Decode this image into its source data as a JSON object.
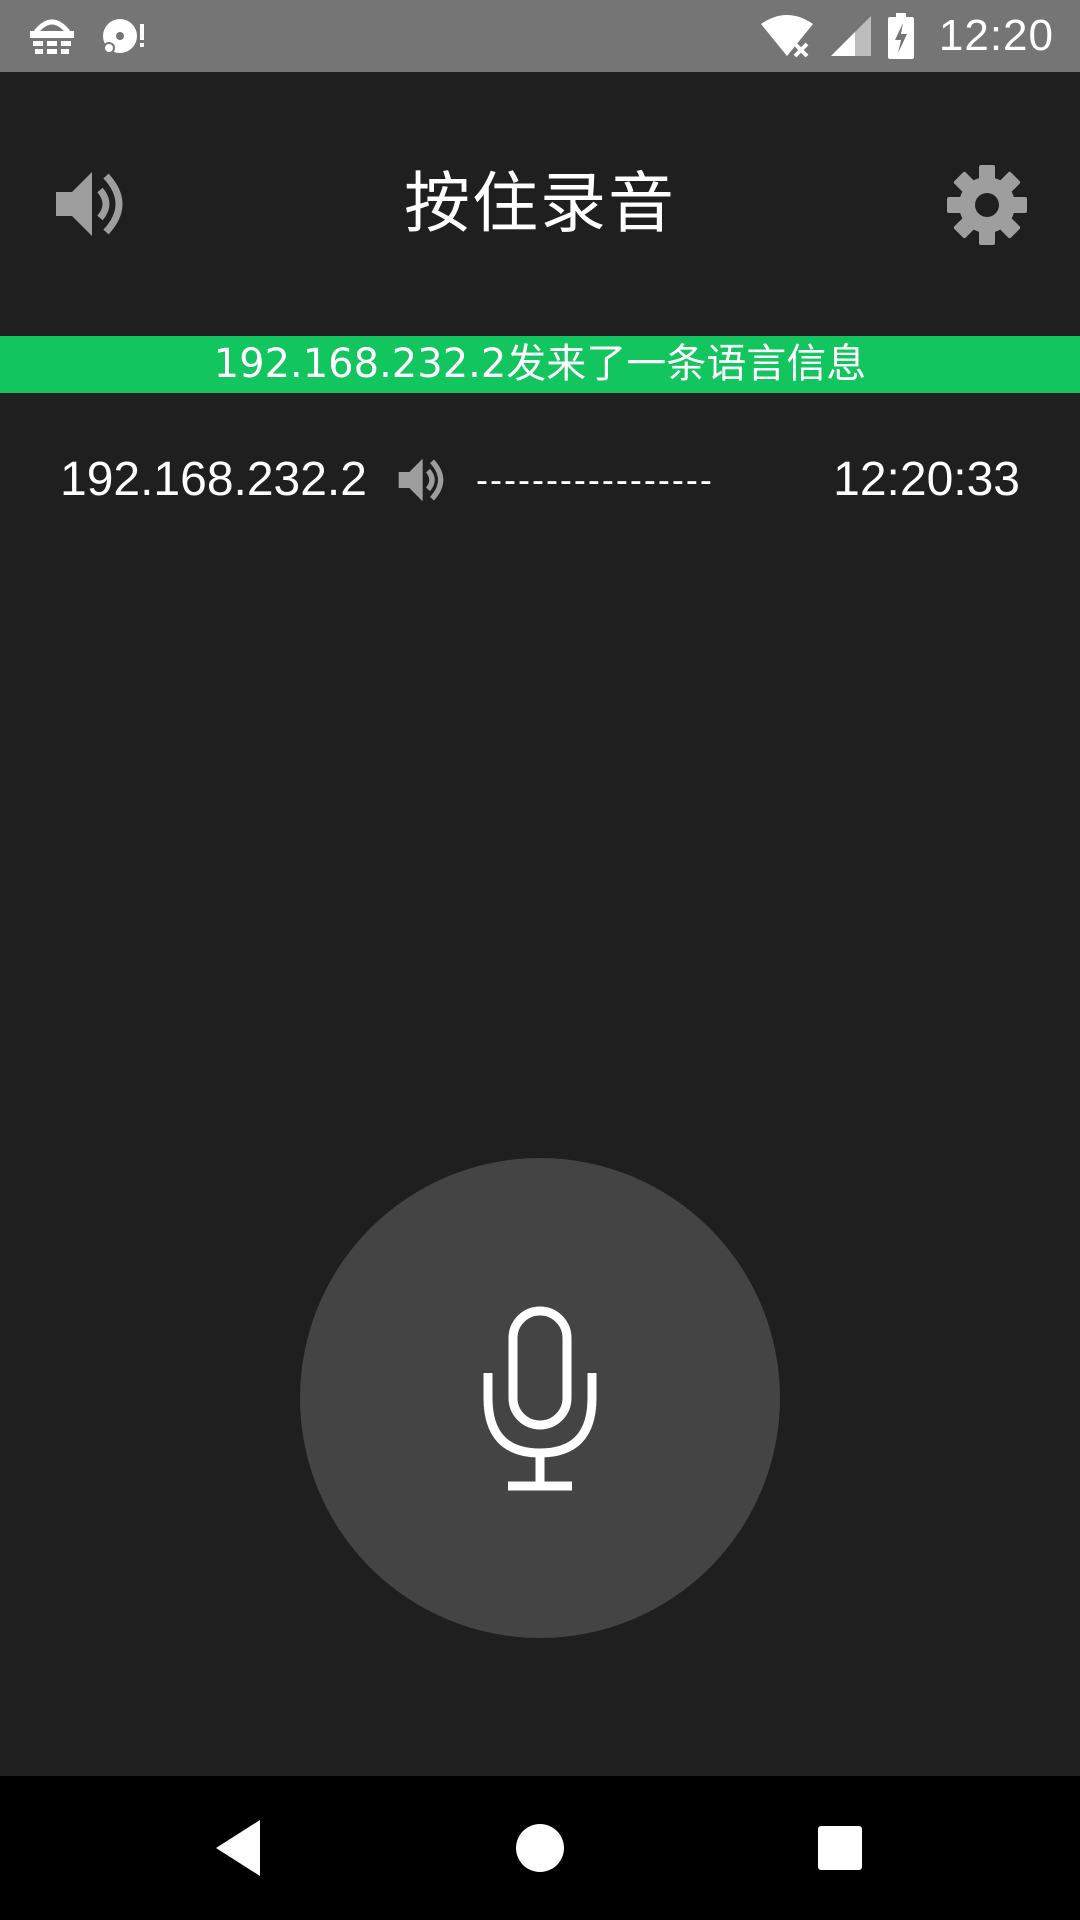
{
  "status_bar": {
    "time": "12:20",
    "left_icons": [
      "basket-icon",
      "disc-alert-icon"
    ],
    "right_icons": [
      "wifi-off-icon",
      "cellular-signal-icon",
      "battery-charging-icon"
    ]
  },
  "header": {
    "title": "按住录音",
    "left_icon": "speaker-icon",
    "right_icon": "gear-icon"
  },
  "banner": {
    "text": "192.168.232.2发来了一条语言信息",
    "color": "#12c55e"
  },
  "messages": [
    {
      "sender": "192.168.232.2",
      "icon": "speaker-icon",
      "duration_bar": "-----------------",
      "time": "12:20:33"
    }
  ],
  "record_button": {
    "icon": "microphone-icon",
    "color": "#444444"
  },
  "nav_bar": {
    "buttons": [
      "back-icon",
      "home-icon",
      "recents-icon"
    ]
  },
  "colors": {
    "background": "#1f1f1f",
    "status_bar": "#757575",
    "accent_green": "#12c55e",
    "icon_gray": "#9e9e9e"
  }
}
